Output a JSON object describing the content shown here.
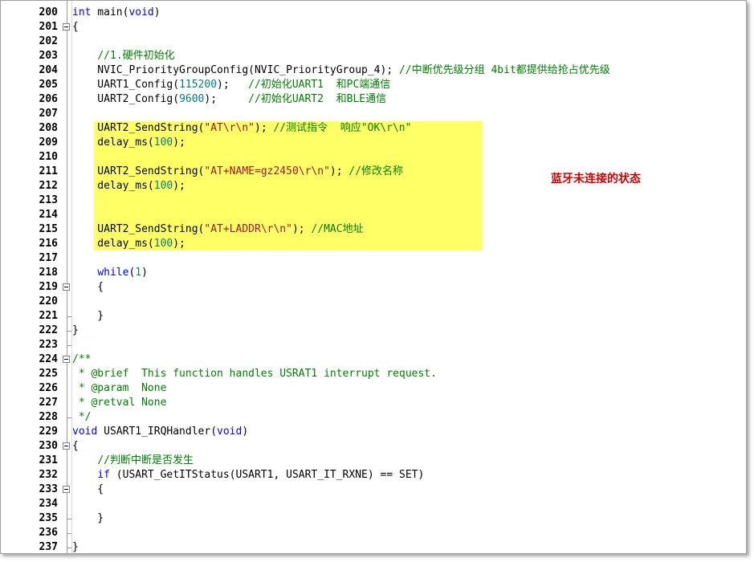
{
  "annotation": "蓝牙未连接的状态",
  "lines": [
    {
      "n": "200",
      "text": "int main(void)"
    },
    {
      "n": "201",
      "text": "{"
    },
    {
      "n": "202",
      "text": ""
    },
    {
      "n": "203",
      "text": "    //1.硬件初始化"
    },
    {
      "n": "204",
      "text": "    NVIC_PriorityGroupConfig(NVIC_PriorityGroup_4); //中断优先级分组 4bit都提供给抢占优先级"
    },
    {
      "n": "205",
      "text": "    UART1_Config(115200);   //初始化UART1  和PC端通信"
    },
    {
      "n": "206",
      "text": "    UART2_Config(9600);     //初始化UART2  和BLE通信"
    },
    {
      "n": "207",
      "text": ""
    },
    {
      "n": "208",
      "text": "    UART2_SendString(\"AT\\r\\n\"); //测试指令  响应\"OK\\r\\n\""
    },
    {
      "n": "209",
      "text": "    delay_ms(100);"
    },
    {
      "n": "210",
      "text": ""
    },
    {
      "n": "211",
      "text": "    UART2_SendString(\"AT+NAME=gz2450\\r\\n\"); //修改名称"
    },
    {
      "n": "212",
      "text": "    delay_ms(100);"
    },
    {
      "n": "213",
      "text": ""
    },
    {
      "n": "214",
      "text": ""
    },
    {
      "n": "215",
      "text": "    UART2_SendString(\"AT+LADDR\\r\\n\"); //MAC地址"
    },
    {
      "n": "216",
      "text": "    delay_ms(100);"
    },
    {
      "n": "217",
      "text": ""
    },
    {
      "n": "218",
      "text": "    while(1)"
    },
    {
      "n": "219",
      "text": "    {"
    },
    {
      "n": "220",
      "text": ""
    },
    {
      "n": "221",
      "text": "    }"
    },
    {
      "n": "222",
      "text": "}"
    },
    {
      "n": "223",
      "text": ""
    },
    {
      "n": "224",
      "text": "/**"
    },
    {
      "n": "225",
      "text": " * @brief  This function handles USRAT1 interrupt request."
    },
    {
      "n": "226",
      "text": " * @param  None"
    },
    {
      "n": "227",
      "text": " * @retval None"
    },
    {
      "n": "228",
      "text": " */"
    },
    {
      "n": "229",
      "text": "void USART1_IRQHandler(void)"
    },
    {
      "n": "230",
      "text": "{"
    },
    {
      "n": "231",
      "text": "    //判断中断是否发生"
    },
    {
      "n": "232",
      "text": "    if (USART_GetITStatus(USART1, USART_IT_RXNE) == SET)"
    },
    {
      "n": "233",
      "text": "    {"
    },
    {
      "n": "234",
      "text": ""
    },
    {
      "n": "235",
      "text": "    }"
    },
    {
      "n": "236",
      "text": ""
    },
    {
      "n": "237",
      "text": "}"
    }
  ]
}
